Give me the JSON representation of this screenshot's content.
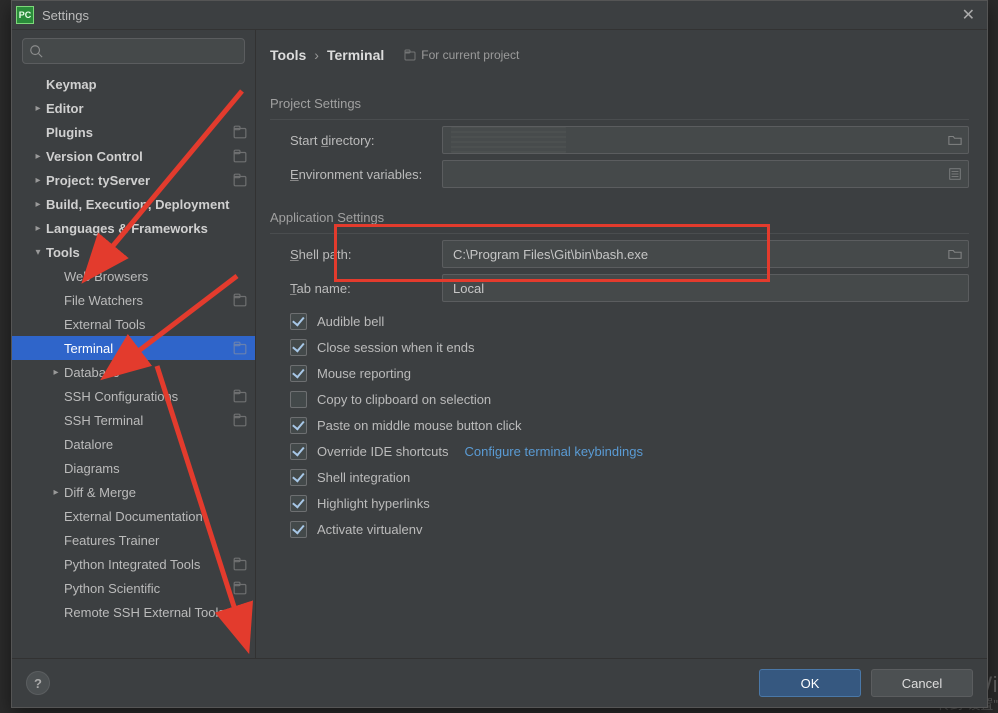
{
  "window": {
    "title": "Settings",
    "app_icon_text": "PC"
  },
  "search": {
    "placeholder": ""
  },
  "sidebar": {
    "nodes": [
      {
        "label": "Keymap",
        "bold": true,
        "arrow": "",
        "indent": 0
      },
      {
        "label": "Editor",
        "bold": true,
        "arrow": ">",
        "indent": 0
      },
      {
        "label": "Plugins",
        "bold": true,
        "arrow": "",
        "indent": 0,
        "proj": true
      },
      {
        "label": "Version Control",
        "bold": true,
        "arrow": ">",
        "indent": 0,
        "proj": true
      },
      {
        "label": "Project: tyServer",
        "bold": true,
        "arrow": ">",
        "indent": 0,
        "proj": true
      },
      {
        "label": "Build, Execution, Deployment",
        "bold": true,
        "arrow": ">",
        "indent": 0
      },
      {
        "label": "Languages & Frameworks",
        "bold": true,
        "arrow": ">",
        "indent": 0
      },
      {
        "label": "Tools",
        "bold": true,
        "arrow": "v",
        "indent": 0
      },
      {
        "label": "Web Browsers",
        "arrow": "",
        "indent": 1
      },
      {
        "label": "File Watchers",
        "arrow": "",
        "indent": 1,
        "proj": true
      },
      {
        "label": "External Tools",
        "arrow": "",
        "indent": 1
      },
      {
        "label": "Terminal",
        "arrow": "",
        "indent": 1,
        "selected": true,
        "proj": true
      },
      {
        "label": "Database",
        "arrow": ">",
        "indent": 1
      },
      {
        "label": "SSH Configurations",
        "arrow": "",
        "indent": 1,
        "proj": true
      },
      {
        "label": "SSH Terminal",
        "arrow": "",
        "indent": 1,
        "proj": true
      },
      {
        "label": "Datalore",
        "arrow": "",
        "indent": 1
      },
      {
        "label": "Diagrams",
        "arrow": "",
        "indent": 1
      },
      {
        "label": "Diff & Merge",
        "arrow": ">",
        "indent": 1
      },
      {
        "label": "External Documentation",
        "arrow": "",
        "indent": 1
      },
      {
        "label": "Features Trainer",
        "arrow": "",
        "indent": 1
      },
      {
        "label": "Python Integrated Tools",
        "arrow": "",
        "indent": 1,
        "proj": true
      },
      {
        "label": "Python Scientific",
        "arrow": "",
        "indent": 1,
        "proj": true
      },
      {
        "label": "Remote SSH External Tools",
        "arrow": "",
        "indent": 1
      }
    ]
  },
  "breadcrumb": {
    "root": "Tools",
    "leaf": "Terminal",
    "forproj": "For current project"
  },
  "project_settings": {
    "title": "Project Settings",
    "start_dir_label": "Start directory:",
    "env_label": "Environment variables:"
  },
  "app_settings": {
    "title": "Application Settings",
    "shell_label": "Shell path:",
    "shell_value": "C:\\Program Files\\Git\\bin\\bash.exe",
    "tab_label": "Tab name:",
    "tab_value": "Local",
    "checks": [
      {
        "label": "Audible bell",
        "checked": true
      },
      {
        "label": "Close session when it ends",
        "checked": true
      },
      {
        "label": "Mouse reporting",
        "checked": true
      },
      {
        "label": "Copy to clipboard on selection",
        "checked": false
      },
      {
        "label": "Paste on middle mouse button click",
        "checked": true
      },
      {
        "label": "Override IDE shortcuts",
        "checked": true,
        "link": "Configure terminal keybindings"
      },
      {
        "label": "Shell integration",
        "checked": true
      },
      {
        "label": "Highlight hyperlinks",
        "checked": true
      },
      {
        "label": "Activate virtualenv",
        "checked": true
      }
    ]
  },
  "footer": {
    "ok": "OK",
    "cancel": "Cancel",
    "help": "?"
  },
  "watermark": {
    "big": "激活 Wi",
    "small": "转到\"设置\""
  }
}
